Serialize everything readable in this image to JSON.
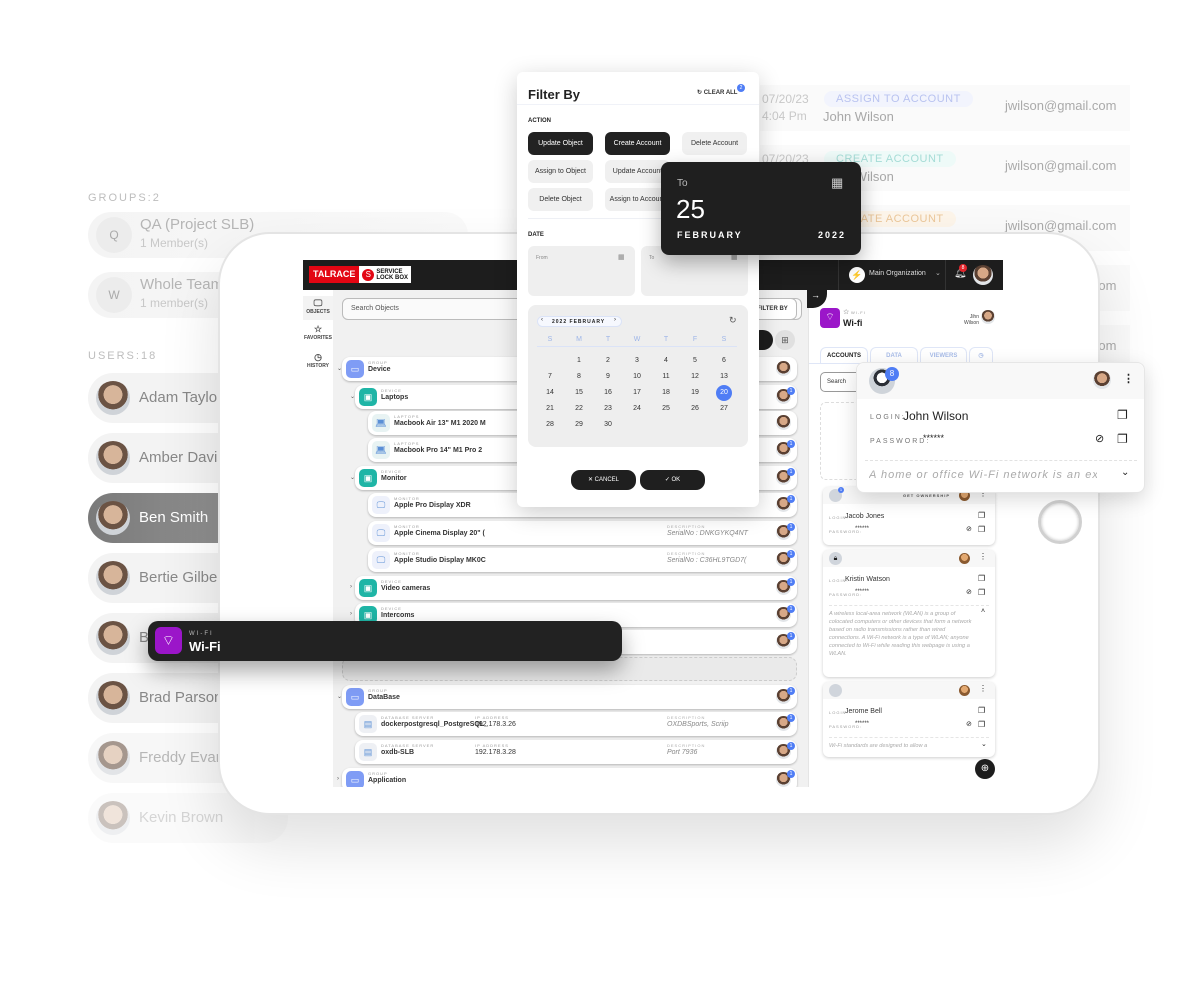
{
  "background": {
    "groups_label": "GROUPS:2",
    "groups": [
      {
        "initial": "Q",
        "name": "QA (Project SLB)",
        "members": "1 Member(s)"
      },
      {
        "initial": "W",
        "name": "Whole Team",
        "members": "1 member(s)"
      }
    ],
    "users_label": "USERS:18",
    "users": [
      {
        "name": "Adam Taylor",
        "selected": false
      },
      {
        "name": "Amber Davis",
        "selected": false
      },
      {
        "name": "Ben Smith",
        "selected": true
      },
      {
        "name": "Bertie Gilbert",
        "selected": false
      },
      {
        "name": "B",
        "selected": false
      },
      {
        "name": "Brad Parsons",
        "selected": false
      },
      {
        "name": "Freddy Evans",
        "selected": false
      },
      {
        "name": "Kevin Brown",
        "selected": false
      }
    ],
    "activity": [
      {
        "date": "07/20/23",
        "time": "4:04 Pm",
        "action": "ASSIGN TO ACCOUNT",
        "action_color": "#b9c3f0",
        "action_bg": "#f2f4fd",
        "name": "John Wilson",
        "email": "jwilson@gmail.com"
      },
      {
        "date": "07/20/23",
        "time": "",
        "action": "CREATE ACCOUNT",
        "action_color": "#a5dcd6",
        "action_bg": "#eefaf8",
        "name": "John Wilson",
        "email": "jwilson@gmail.com"
      },
      {
        "date": "",
        "time": "",
        "action": "CREATE ACCOUNT",
        "action_color": "#ebc79a",
        "action_bg": "#fdf5ea",
        "name": "",
        "email": "jwilson@gmail.com"
      },
      {
        "date": "",
        "time": "",
        "action": "",
        "name": "",
        "email": "jwilson@gmail.com"
      },
      {
        "date": "",
        "time": "",
        "action": "",
        "name": "",
        "email": "jwilson@gmail.com"
      }
    ]
  },
  "app": {
    "brand": "TALRACE",
    "product_line1": "SERVICE",
    "product_line2": "LOCK BOX",
    "organization": "Main Organization",
    "notification_count": "8",
    "nav": [
      {
        "label": "OBJECTS",
        "icon": "monitor-icon"
      },
      {
        "label": "FAVORITES",
        "icon": "star-icon"
      },
      {
        "label": "HISTORY",
        "icon": "clock-icon"
      }
    ],
    "search_placeholder": "Search Objects",
    "filter_button": "FILTER BY",
    "rows": [
      {
        "kind": "GROUP",
        "name": "Device",
        "level": 0,
        "type": "group",
        "badge": ""
      },
      {
        "kind": "DEVICE",
        "name": "Laptops",
        "level": 1,
        "type": "device",
        "badge": "1"
      },
      {
        "kind": "LAPTOPS",
        "name": "Macbook Air 13\" M1 2020 M",
        "level": 2,
        "type": "laptop",
        "badge": ""
      },
      {
        "kind": "LAPTOPS",
        "name": "Macbook Pro 14\" M1 Pro 2",
        "level": 2,
        "type": "laptop",
        "badge": "1"
      },
      {
        "kind": "DEVICE",
        "name": "Monitor",
        "level": 1,
        "type": "device",
        "badge": "1"
      },
      {
        "kind": "MONITOR",
        "name": "Apple Pro Display XDR",
        "level": 2,
        "type": "monitor",
        "badge": "1",
        "desc_label": "",
        "desc": "SerialNo : FFYFK0E80PC"
      },
      {
        "kind": "MONITOR",
        "name": "Apple Cinema Display 20\" (",
        "level": 2,
        "type": "monitor",
        "badge": "1",
        "desc_label": "DESCRIPTION",
        "desc": "SerialNo : DNKGYKQ4NT"
      },
      {
        "kind": "MONITOR",
        "name": "Apple Studio Display MK0C",
        "level": 2,
        "type": "monitor",
        "badge": "1",
        "desc_label": "DESCRIPTION",
        "desc": "SerialNo : C36HL9TGD7("
      },
      {
        "kind": "DEVICE",
        "name": "Video cameras",
        "level": 1,
        "type": "device",
        "badge": "1"
      },
      {
        "kind": "DEVICE",
        "name": "Intercoms",
        "level": 1,
        "type": "device",
        "badge": "1"
      },
      {
        "kind": "",
        "name": "",
        "level": 1,
        "type": "hidden",
        "badge": "1"
      },
      {
        "kind": "",
        "name": "",
        "level": 0,
        "type": "empty",
        "badge": ""
      },
      {
        "kind": "GROUP",
        "name": "DataBase",
        "level": 0,
        "type": "group",
        "badge": "1"
      },
      {
        "kind": "DATABASE SERVER",
        "name": "dockerpostgresql_PostgreSQL_",
        "level": 1,
        "type": "db",
        "badge": "1",
        "ip_label": "IP ADDRESS",
        "ip": "192.178.3.26",
        "desc_label": "DESCRIPTION",
        "desc": "OXDBSports, Scriip"
      },
      {
        "kind": "DATABASE SERVER",
        "name": "oxdb-SLB",
        "level": 1,
        "type": "db",
        "badge": "1",
        "ip_label": "IP ADDRESS",
        "ip": "192.178.3.28",
        "desc_label": "DESCRIPTION",
        "desc": "Port 7936"
      },
      {
        "kind": "GROUP",
        "name": "Application",
        "level": 0,
        "type": "group",
        "badge": "1"
      }
    ],
    "detail": {
      "kind": "WI-FI",
      "name": "Wi-fi",
      "owner": "Jihn Wilson",
      "tabs": [
        {
          "label": "ACCOUNTS",
          "active": true,
          "badge": "5"
        },
        {
          "label": "DATA",
          "active": false
        },
        {
          "label": "VIEWERS",
          "active": false
        },
        {
          "label": "",
          "icon": "history-icon",
          "active": false
        }
      ],
      "search_placeholder": "Search",
      "login_label": "LOGIN:",
      "password_label": "PASSWORD:",
      "accounts": [
        {
          "login": "Jacob Jones",
          "password": "******",
          "action": "GET OWNERSHIP",
          "badge": "1",
          "description": ""
        },
        {
          "login": "Kristin Watson",
          "password": "******",
          "action": "",
          "badge": "",
          "locked": true,
          "description": "A wireless local-area network (WLAN) is a group of colocated computers or other devices that form a network based on radio transmissions rather than wired connections. A Wi-Fi network is a type of WLAN; anyone connected to Wi-Fi while reading this webpage is using a WLAN."
        },
        {
          "login": "Jerome Bell",
          "password": "******",
          "action": "",
          "badge": "",
          "description": "Wi-Fi standards are designed to allow a"
        }
      ]
    }
  },
  "filter": {
    "title": "Filter By",
    "clear_all": "CLEAR ALL",
    "clear_count": "2",
    "action_label": "ACTION",
    "actions": [
      {
        "label": "Update Object",
        "active": true
      },
      {
        "label": "Create Account",
        "active": true
      },
      {
        "label": "Delete Account",
        "active": false
      },
      {
        "label": "Assign to Object",
        "active": false
      },
      {
        "label": "Update Account",
        "active": false
      },
      {
        "label": "",
        "active": false
      },
      {
        "label": "Delete Object",
        "active": false
      },
      {
        "label": "Assign to Account",
        "active": false
      },
      {
        "label": "",
        "active": false
      }
    ],
    "date_label": "DATE",
    "from_label": "From",
    "to_label": "To",
    "calendar": {
      "month_label": "2022 FEBRUARY",
      "weekdays": [
        "S",
        "M",
        "T",
        "W",
        "T",
        "F",
        "S"
      ],
      "first_weekday": 1,
      "days": 30,
      "selected_day": 20
    },
    "cancel": "CANCEL",
    "ok": "OK"
  },
  "date_popup": {
    "label": "To",
    "day": "25",
    "month": "FEBRUARY",
    "year": "2022"
  },
  "account_popup": {
    "badge": "8",
    "login_label": "LOGIN:",
    "login": "John Wilson",
    "password_label": "PASSWORD:",
    "password": "******",
    "description": "A home or office Wi-Fi network is an exar"
  },
  "toast": {
    "kind": "WI-FI",
    "name": "Wi-Fi"
  },
  "colors": {
    "accent": "#4f7df5",
    "wifi": "#9b16c9",
    "brand_red": "#e30613",
    "device_teal": "#1fb5a6",
    "group_blue": "#7f9cf5"
  }
}
